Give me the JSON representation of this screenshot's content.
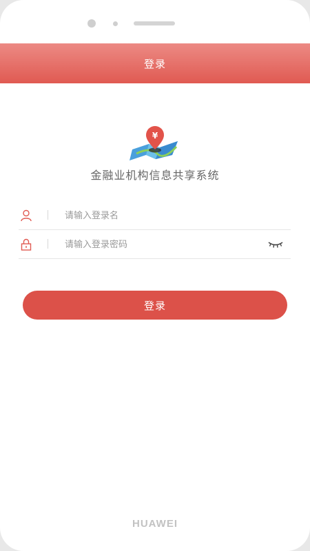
{
  "header": {
    "title": "登录"
  },
  "branding": {
    "logo_symbol": "¥",
    "app_name": "金融业机构信息共享系统"
  },
  "form": {
    "username": {
      "placeholder": "请输入登录名",
      "value": "",
      "icon": "user-icon"
    },
    "password": {
      "placeholder": "请输入登录密码",
      "value": "",
      "icon": "lock-icon",
      "toggle_icon": "eye-closed-icon"
    },
    "submit_label": "登录"
  },
  "device": {
    "brand": "HUAWEI"
  },
  "colors": {
    "accent": "#dc5149",
    "header_top": "#ec8a84",
    "header_bottom": "#e05a52"
  }
}
